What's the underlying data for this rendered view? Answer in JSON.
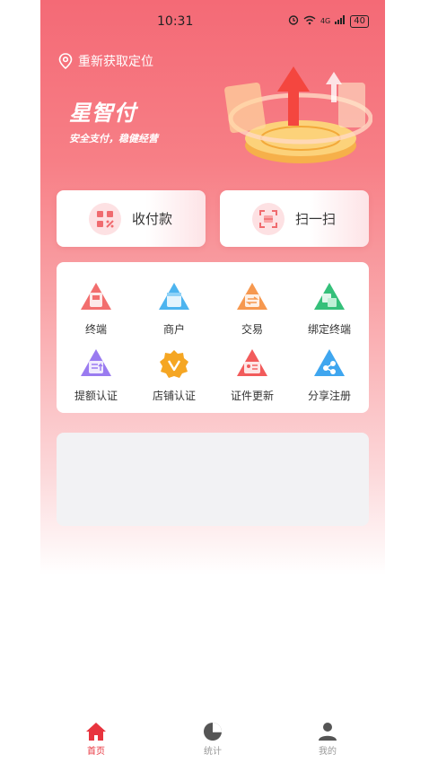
{
  "status": {
    "time": "10:31",
    "battery": "40",
    "signal": "4G"
  },
  "location": {
    "label": "重新获取定位",
    "icon": "location-pin-icon"
  },
  "brand": {
    "title": "星智付",
    "subtitle": "安全支付，稳健经营"
  },
  "actions": [
    {
      "label": "收付款",
      "icon": "qr-pay-icon"
    },
    {
      "label": "扫一扫",
      "icon": "scan-icon"
    }
  ],
  "grid": [
    {
      "label": "终端",
      "icon": "terminal-icon"
    },
    {
      "label": "商户",
      "icon": "merchant-icon"
    },
    {
      "label": "交易",
      "icon": "transaction-icon"
    },
    {
      "label": "绑定终端",
      "icon": "bind-terminal-icon"
    },
    {
      "label": "提额认证",
      "icon": "limit-certify-icon"
    },
    {
      "label": "店铺认证",
      "icon": "shop-certify-icon"
    },
    {
      "label": "证件更新",
      "icon": "id-update-icon"
    },
    {
      "label": "分享注册",
      "icon": "share-register-icon"
    }
  ],
  "tabs": [
    {
      "label": "首页",
      "icon": "home-icon"
    },
    {
      "label": "统计",
      "icon": "pie-chart-icon"
    },
    {
      "label": "我的",
      "icon": "user-icon"
    }
  ],
  "colors": {
    "accent": "#e8343e",
    "header_top": "#f46a76"
  }
}
